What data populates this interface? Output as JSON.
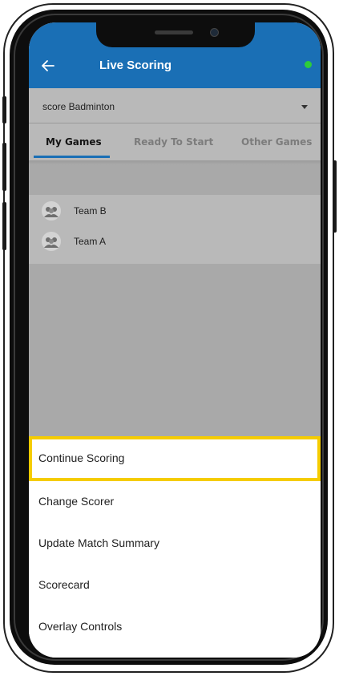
{
  "header": {
    "title": "Live Scoring",
    "back_icon": "arrow-left-icon",
    "status_color": "#2dcd3a"
  },
  "dropdown": {
    "selected": "score Badminton"
  },
  "tabs": [
    {
      "label": "My Games",
      "active": true
    },
    {
      "label": "Ready To Start",
      "active": false
    },
    {
      "label": "Other Games",
      "active": false
    }
  ],
  "teams": [
    {
      "name": "Team B"
    },
    {
      "name": "Team A"
    }
  ],
  "menu": [
    {
      "label": "Continue Scoring",
      "highlighted": true
    },
    {
      "label": "Change Scorer"
    },
    {
      "label": "Update Match Summary"
    },
    {
      "label": "Scorecard"
    },
    {
      "label": "Overlay Controls"
    }
  ],
  "colors": {
    "app_bar": "#1a6fb5",
    "highlight": "#f5cc00",
    "status_dot": "#2dcd3a"
  }
}
